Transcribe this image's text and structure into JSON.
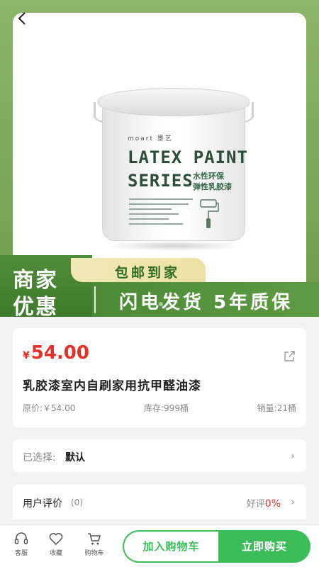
{
  "colors": {
    "accent": "#3dbd5a",
    "price": "#e63025",
    "promo_green": "#4c8a37",
    "badge_yellow": "#f1e9b8"
  },
  "header": {
    "back_icon": "chevron-left-icon"
  },
  "hero_image": {
    "brand": "moart 墨艺",
    "line1": "LATEX PAINT",
    "line2": "SERIES",
    "cn_line1": "水性环保",
    "cn_line2": "弹性乳胶漆"
  },
  "promo": {
    "left_line1": "商家",
    "left_line2": "优惠",
    "badge": "包邮到家",
    "slogan": "闪电发货 5年质保"
  },
  "product": {
    "currency": "¥",
    "price": "54.00",
    "title": "乳胶漆室内自刷家用抗甲醛油漆",
    "orig_price": "原价:￥54.00",
    "stock": "库存:999桶",
    "sales": "销量:21桶",
    "share_icon": "share-icon"
  },
  "selection": {
    "label": "已选择:",
    "value": "默认",
    "chevron": "›"
  },
  "reviews": {
    "label": "用户评价",
    "count": "(0)",
    "good_label": "好评",
    "good_pct": "0%",
    "chevron": "›"
  },
  "bottom_bar": {
    "service": "客服",
    "favorite": "收藏",
    "cart": "购物车",
    "add_cart": "加入购物车",
    "buy_now": "立即购买"
  }
}
